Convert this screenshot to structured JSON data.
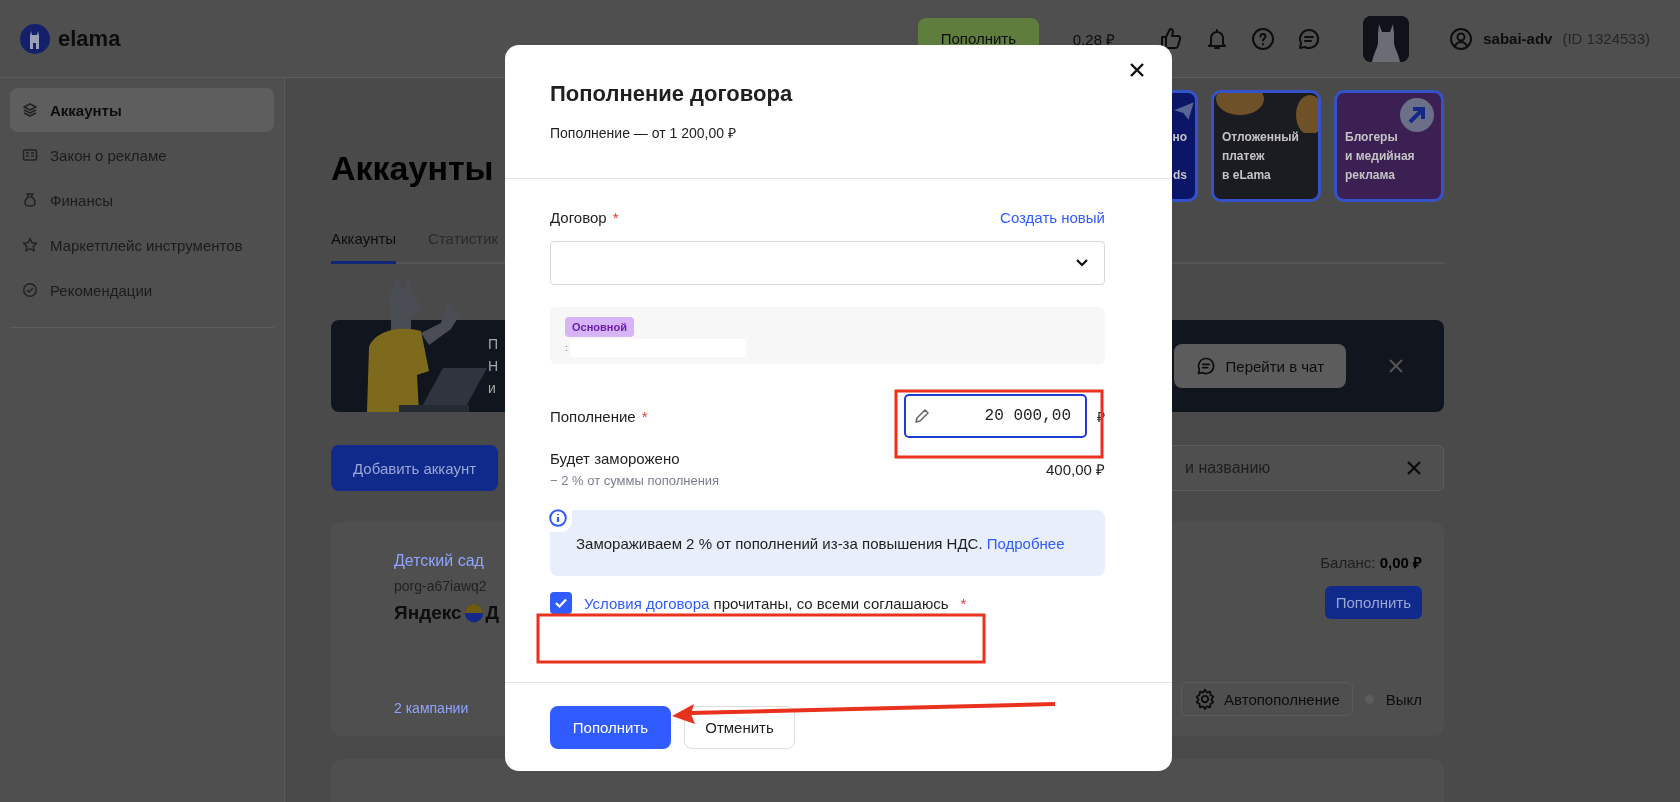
{
  "header": {
    "logo_text": "elama",
    "topup_button": "Пополнить",
    "balance": "0,28 ₽",
    "username": "sabai-adv",
    "user_id": "(ID 1324533)"
  },
  "sidebar": {
    "items": [
      {
        "label": "Аккаунты",
        "selected": true
      },
      {
        "label": "Закон о рекламе",
        "selected": false
      },
      {
        "label": "Финансы",
        "selected": false
      },
      {
        "label": "Маркетплейс инструментов",
        "selected": false
      },
      {
        "label": "Рекомендации",
        "selected": false
      }
    ]
  },
  "page": {
    "title": "Аккаунты",
    "tabs": [
      {
        "label": "Аккаунты",
        "selected": true
      },
      {
        "label": "Статистик",
        "selected": false
      }
    ]
  },
  "promo_cards": [
    {
      "lines": [
        "но",
        "ds"
      ],
      "color": "#0b1668"
    },
    {
      "lines": [
        "Отложенный",
        "платеж",
        "в eLama"
      ],
      "color": "#1a1c22"
    },
    {
      "lines": [
        "Блогеры",
        "и медийная",
        "реклама"
      ],
      "color": "#3c2054"
    }
  ],
  "banner": {
    "lines": [
      "П",
      "Н",
      "и"
    ],
    "chat_button": "Перейти в чат"
  },
  "toolbar": {
    "add_button": "Добавить аккаунт",
    "search_placeholder": "и названию"
  },
  "account_card": {
    "name": "Детский сад",
    "login": "porg-a67iawq2",
    "platform": [
      "Яндекс",
      "Д"
    ],
    "campaigns": "2 кампании",
    "balance": "Баланс: **0,00 ₽**",
    "topup_button": "Пополнить",
    "autotopup_button": "Автопополнение",
    "autotopup_on": false,
    "autotopup_status": "Выкл"
  },
  "modal": {
    "title": "Пополнение договора",
    "subtitle": "Пополнение — от 1 200,00 ₽",
    "contract_label": "Договор",
    "required_mark": "*",
    "create_link": "Создать новый",
    "contract_badge": "Основной",
    "contract_detail": ":",
    "amount_label": "Пополнение",
    "amount_value": "20 000,00",
    "currency": "₽",
    "frozen_label": "Будет заморожено",
    "frozen_note": "− 2 % от суммы пополнения",
    "frozen_value": "400,00 ₽",
    "info_text": "Замораживаем 2 % от пополнений из-за повышения НДС.",
    "info_link": "Подробнее",
    "terms_checked": true,
    "terms_link": "Условия договора",
    "terms_text": "прочитаны, со всеми соглашаюсь",
    "submit_button": "Пополнить",
    "cancel_button": "Отменить"
  }
}
